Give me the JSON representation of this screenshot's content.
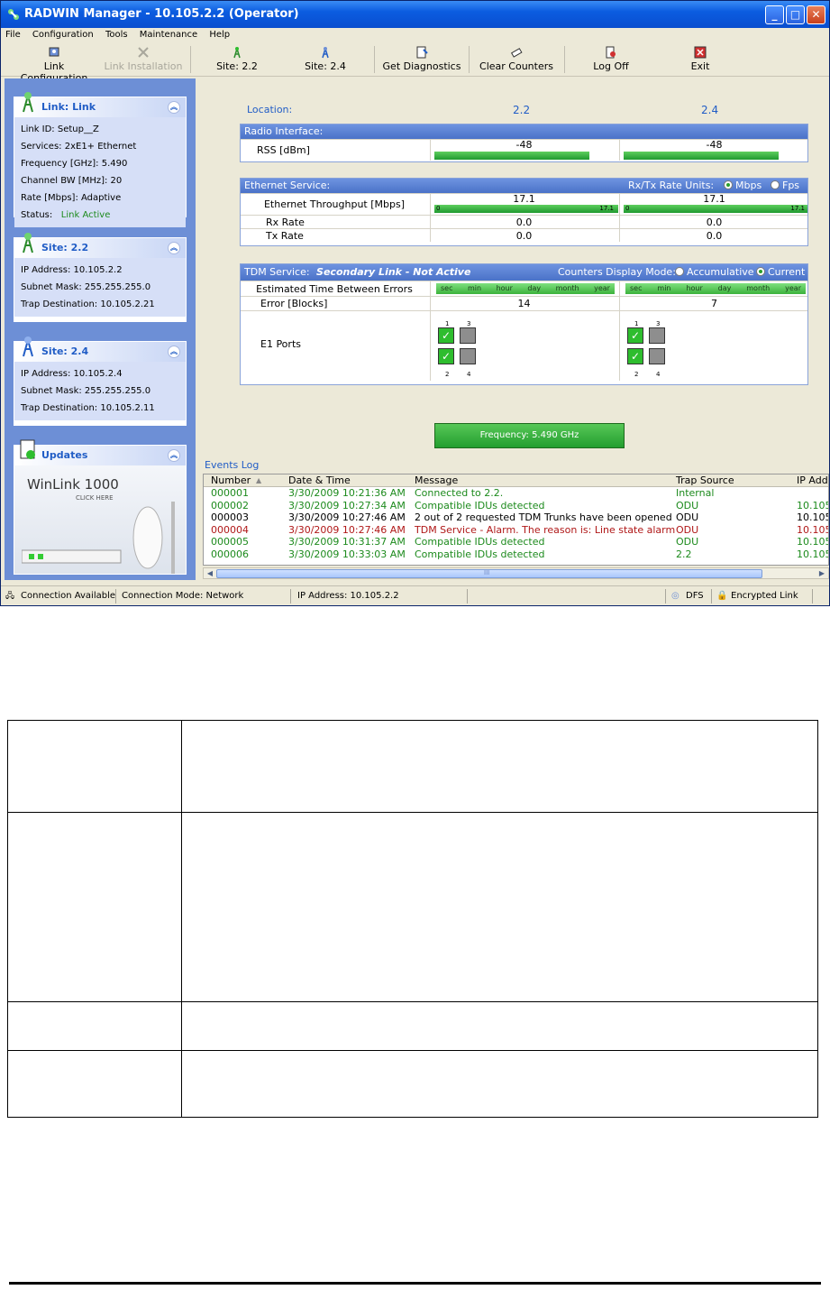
{
  "window": {
    "title": "RADWIN Manager - 10.105.2.2 (Operator)",
    "controls": {
      "minimize": "_",
      "maximize": "□",
      "close": "✕"
    }
  },
  "menu": [
    "File",
    "Configuration",
    "Tools",
    "Maintenance",
    "Help"
  ],
  "toolbar": {
    "link_configuration": "Link Configuration",
    "link_installation": "Link Installation",
    "site_a": "Site: 2.2",
    "site_b": "Site: 2.4",
    "get_diagnostics": "Get Diagnostics",
    "clear_counters": "Clear Counters",
    "log_off": "Log Off",
    "exit": "Exit"
  },
  "sidebar": {
    "link_panel": {
      "title": "Link: Link",
      "rows": [
        "Link ID:   Setup__Z",
        "Services:   2xE1+ Ethernet",
        "Frequency [GHz]:   5.490",
        "Channel BW [MHz]:   20",
        "Rate [Mbps]:   Adaptive"
      ],
      "status_label": "Status:",
      "status_value": "Link Active"
    },
    "site_a_panel": {
      "title": "Site: 2.2",
      "rows": [
        "IP Address:   10.105.2.2",
        "Subnet Mask:   255.255.255.0",
        "Trap Destination:   10.105.2.21"
      ]
    },
    "site_b_panel": {
      "title": "Site: 2.4",
      "rows": [
        "IP Address:   10.105.2.4",
        "Subnet Mask:   255.255.255.0",
        "Trap Destination:   10.105.2.11"
      ]
    },
    "updates_panel": {
      "title": "Updates",
      "banner_title": "WinLink 1000",
      "banner_sub": "CLICK HERE"
    }
  },
  "main": {
    "location_label": "Location:",
    "site_a": "2.2",
    "site_b": "2.4",
    "radio": {
      "header": "Radio Interface:",
      "rss_label": "RSS [dBm]",
      "rss_a": "-48",
      "rss_b": "-48"
    },
    "ethernet": {
      "header": "Ethernet Service:",
      "units_label": "Rx/Tx Rate Units:",
      "unit_mbps": "Mbps",
      "unit_fps": "Fps",
      "throughput_label": "Ethernet Throughput [Mbps]",
      "throughput_a": "17.1",
      "throughput_b": "17.1",
      "scale_min": "0",
      "scale_max": "17.1",
      "rx_label": "Rx Rate",
      "rx_a": "0.0",
      "rx_b": "0.0",
      "tx_label": "Tx Rate",
      "tx_a": "0.0",
      "tx_b": "0.0"
    },
    "tdm": {
      "header": "TDM Service:",
      "header_status": "Secondary Link - Not Active",
      "mode_label": "Counters Display Mode:",
      "mode_accumulative": "Accumulative",
      "mode_current": "Current",
      "ete_label": "Estimated Time Between Errors",
      "scale": [
        "sec",
        "min",
        "hour",
        "day",
        "month",
        "year"
      ],
      "error_label": "Error [Blocks]",
      "error_a": "14",
      "error_b": "7",
      "ports_label": "E1 Ports",
      "port_numbers": [
        "1",
        "3",
        "2",
        "4"
      ],
      "check_glyph": "✓"
    },
    "frequency_button": "Frequency: 5.490 GHz"
  },
  "events": {
    "title": "Events Log",
    "columns": [
      "Number",
      "Date & Time",
      "Message",
      "Trap Source",
      "IP Add"
    ],
    "rows": [
      {
        "number": "000001",
        "datetime": "3/30/2009 10:21:36 AM",
        "message": "Connected to 2.2.",
        "source": "Internal",
        "ip": "",
        "color": "#1c8a1c"
      },
      {
        "number": "000002",
        "datetime": "3/30/2009 10:27:34 AM",
        "message": "Compatible IDUs detected",
        "source": "ODU",
        "ip": "10.105",
        "color": "#1c8a1c"
      },
      {
        "number": "000003",
        "datetime": "3/30/2009 10:27:46 AM",
        "message": "2 out of 2 requested TDM Trunks have been opened",
        "source": "ODU",
        "ip": "10.105",
        "color": "#000000"
      },
      {
        "number": "000004",
        "datetime": "3/30/2009 10:27:46 AM",
        "message": "TDM Service - Alarm. The reason is: Line state alarm",
        "source": "ODU",
        "ip": "10.105",
        "color": "#b01818"
      },
      {
        "number": "000005",
        "datetime": "3/30/2009 10:31:37 AM",
        "message": "Compatible IDUs detected",
        "source": "ODU",
        "ip": "10.105",
        "color": "#1c8a1c"
      },
      {
        "number": "000006",
        "datetime": "3/30/2009 10:33:03 AM",
        "message": "Compatible IDUs detected",
        "source": "2.2",
        "ip": "10.105",
        "color": "#1c8a1c"
      }
    ],
    "scroll_thumb_grip": "III"
  },
  "status": {
    "connection": "Connection Available",
    "mode": "Connection Mode: Network",
    "ip": "IP Address: 10.105.2.2",
    "dfs": "DFS",
    "encrypted": "Encrypted Link"
  },
  "colors": {
    "accent": "#215dc6",
    "ok_green": "#1c8a1c",
    "alarm_red": "#b01818",
    "bar_green": "#2ea02e"
  }
}
